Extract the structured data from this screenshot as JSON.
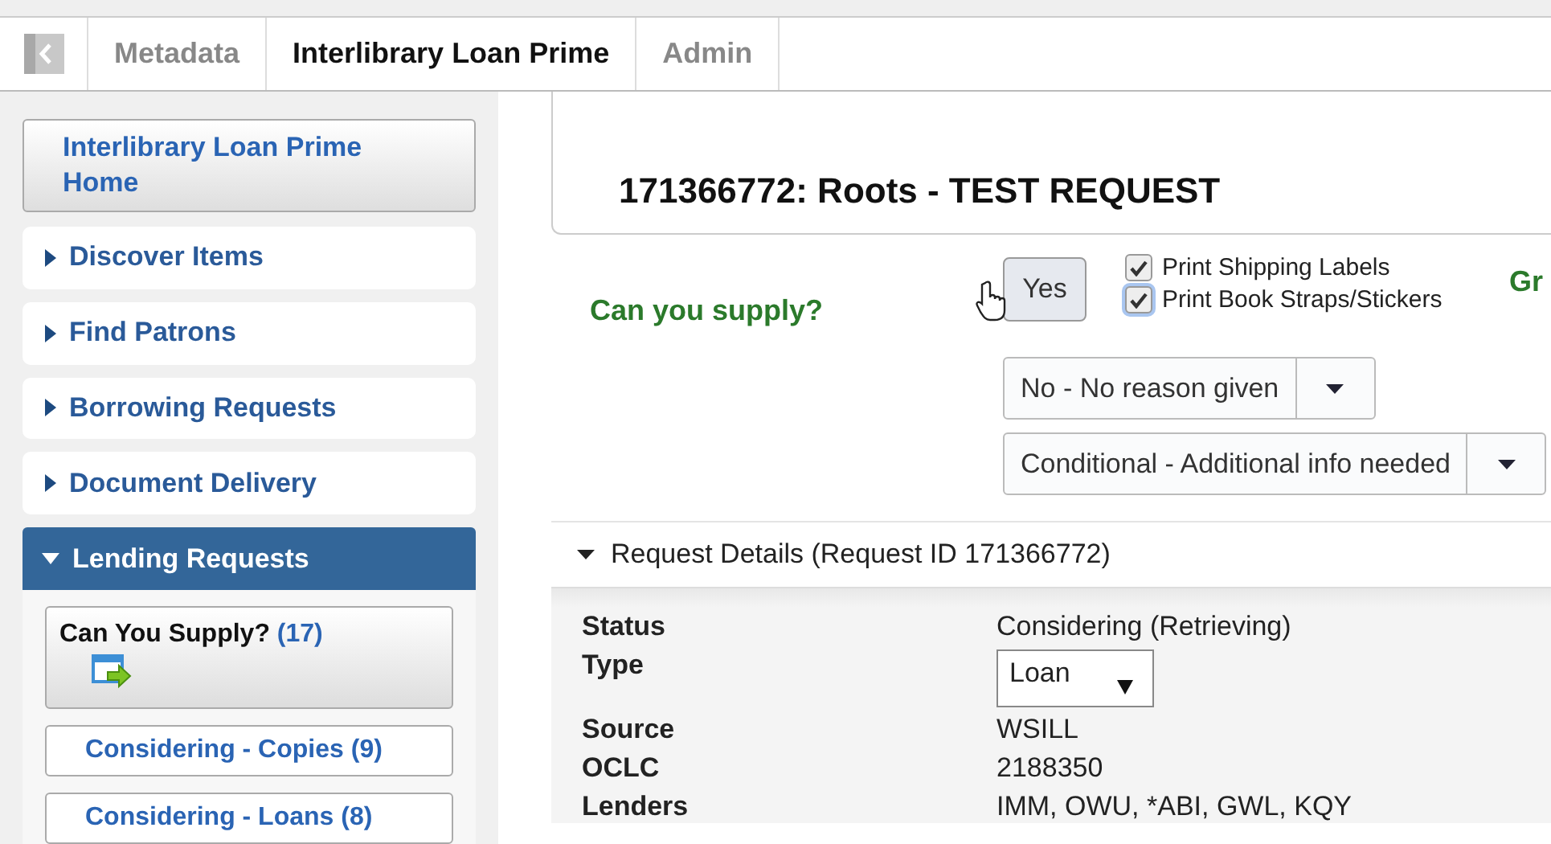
{
  "tabs": [
    {
      "label": "Metadata",
      "selected": false
    },
    {
      "label": "Interlibrary Loan Prime",
      "selected": true
    },
    {
      "label": "Admin",
      "selected": false
    }
  ],
  "sidebar": {
    "home": "Interlibrary Loan Prime Home",
    "sections": [
      {
        "label": "Discover Items",
        "expanded": false
      },
      {
        "label": "Find Patrons",
        "expanded": false
      },
      {
        "label": "Borrowing Requests",
        "expanded": false
      },
      {
        "label": "Document Delivery",
        "expanded": false
      },
      {
        "label": "Lending Requests",
        "expanded": true
      }
    ],
    "subitems": [
      {
        "label": "Can You Supply?",
        "count": "(17)",
        "selected": true
      },
      {
        "label": "Considering - Copies",
        "count": "(9)",
        "selected": false
      },
      {
        "label": "Considering - Loans",
        "count": "(8)",
        "selected": false
      }
    ]
  },
  "request": {
    "title": "171366772: Roots - TEST REQUEST",
    "supply_question": "Can you supply?",
    "yes_button": "Yes",
    "checkboxes": [
      {
        "label": "Print Shipping Labels",
        "checked": true
      },
      {
        "label": "Print Book Straps/Stickers",
        "checked": true
      }
    ],
    "next_heading": "Gr",
    "dropdowns": [
      {
        "value": "No - No reason given"
      },
      {
        "value": "Conditional - Additional info needed"
      }
    ],
    "details": {
      "header": "Request Details (Request ID 171366772)",
      "expanded": true,
      "fields": [
        {
          "label": "Status",
          "value": "Considering (Retrieving)",
          "kind": "text"
        },
        {
          "label": "Type",
          "value": "Loan",
          "kind": "select"
        },
        {
          "label": "Source",
          "value": "WSILL",
          "kind": "text"
        },
        {
          "label": "OCLC",
          "value": "2188350",
          "kind": "text"
        },
        {
          "label": "Lenders",
          "value": "IMM, OWU, *ABI, GWL, KQY",
          "kind": "text"
        }
      ]
    }
  }
}
